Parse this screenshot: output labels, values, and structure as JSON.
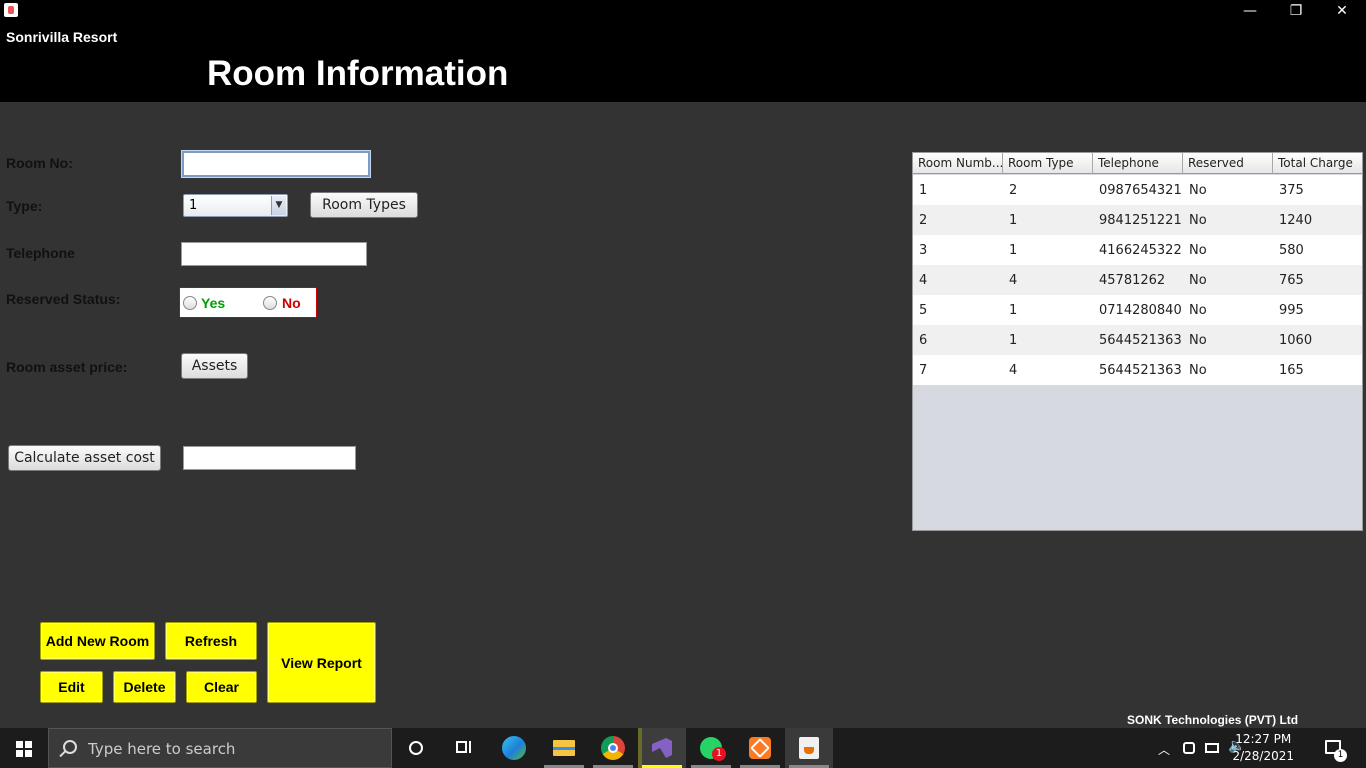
{
  "window": {
    "title": "Sonrivilla Resort",
    "minimize": "—",
    "restore": "❐",
    "close": "✕"
  },
  "page": {
    "title": "Room Information"
  },
  "form": {
    "room_no_label": "Room No:",
    "room_no_value": "",
    "type_label": "Type:",
    "type_selected": "1",
    "room_types_button": "Room Types",
    "telephone_label": "Telephone",
    "telephone_value": "",
    "reserved_label": "Reserved Status:",
    "reserved_yes": "Yes",
    "reserved_no": "No",
    "asset_price_label": "Room asset price:",
    "assets_button": "Assets",
    "calculate_button": "Calculate asset cost",
    "calculate_value": ""
  },
  "actions": {
    "add_new_room": "Add New Room",
    "refresh": "Refresh",
    "view_report": "View Report",
    "edit": "Edit",
    "delete": "Delete",
    "clear": "Clear"
  },
  "table": {
    "columns": [
      "Room Numb...",
      "Room Type",
      "Telephone",
      "Reserved",
      "Total Charge"
    ],
    "rows": [
      [
        "1",
        "2",
        "0987654321",
        "No",
        "375"
      ],
      [
        "2",
        "1",
        "9841251221",
        "No",
        "1240"
      ],
      [
        "3",
        "1",
        "4166245322",
        "No",
        "580"
      ],
      [
        "4",
        "4",
        "45781262",
        "No",
        "765"
      ],
      [
        "5",
        "1",
        "0714280840",
        "No",
        "995"
      ],
      [
        "6",
        "1",
        "5644521363",
        "No",
        "1060"
      ],
      [
        "7",
        "4",
        "5644521363",
        "No",
        "165"
      ]
    ]
  },
  "footer": {
    "brand": "SONK Technologies (PVT) Ltd"
  },
  "taskbar": {
    "search_placeholder": "Type here to search",
    "time": "12:27 PM",
    "date": "2/28/2021",
    "whatsapp_badge": "1",
    "notification_badge": "1",
    "icons": [
      "cortana-icon",
      "task-view-icon",
      "edge-icon",
      "file-explorer-icon",
      "chrome-icon",
      "visual-studio-icon",
      "whatsapp-icon",
      "xampp-icon",
      "java-icon"
    ]
  },
  "colors": {
    "background": "#333333",
    "header": "#000000",
    "action_button": "#ffff00",
    "reserved_yes": "#00a000",
    "reserved_no": "#cc0000"
  }
}
